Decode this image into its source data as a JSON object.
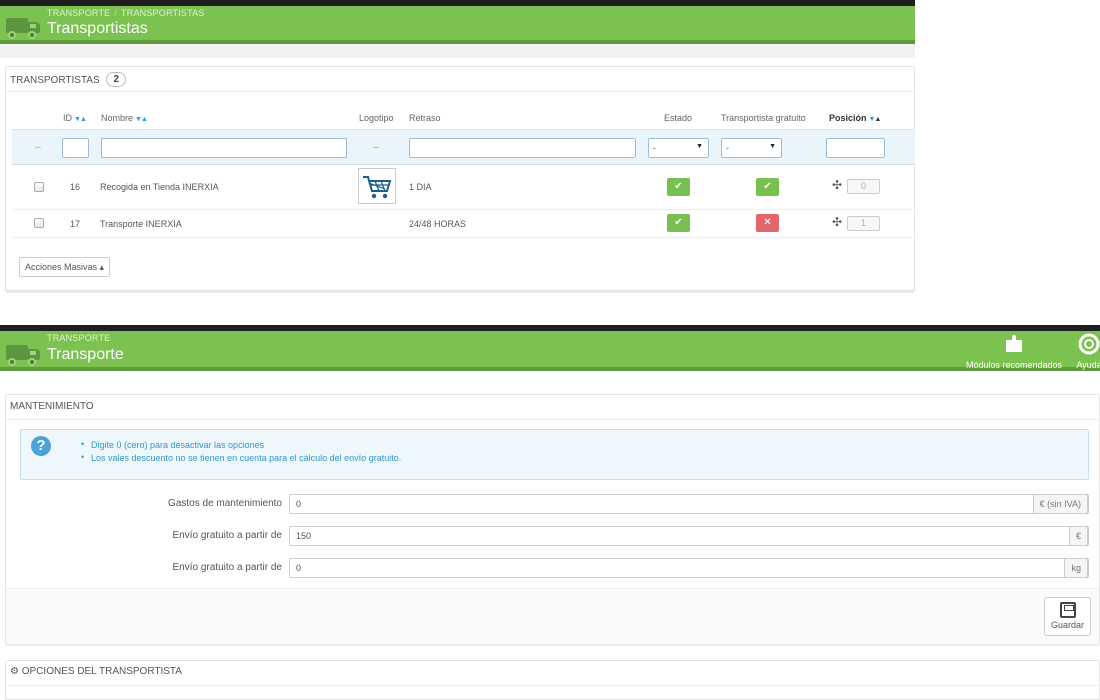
{
  "carriers": {
    "breadcrumb": [
      "TRANSPORTE",
      "TRANSPORTISTAS"
    ],
    "title": "Transportistas",
    "panel_title": "TRANSPORTISTAS",
    "count": "2",
    "columns": {
      "id": "ID",
      "name": "Nombre",
      "logo": "Logotipo",
      "delay": "Retraso",
      "status": "Estado",
      "free": "Transportista gratuito",
      "position": "Posición"
    },
    "filters": {
      "dash1": "--",
      "dash2": "--",
      "status_select": "-",
      "free_select": "-"
    },
    "rows": [
      {
        "id": "16",
        "name": "Recogida en Tienda INERXIA",
        "delay": "1 DIA",
        "status": "enabled",
        "free": "yes",
        "position": "0",
        "has_logo": true
      },
      {
        "id": "17",
        "name": "Transporte INERXIA",
        "delay": "24/48 HORAS",
        "status": "enabled",
        "free": "no",
        "position": "1",
        "has_logo": false
      }
    ],
    "bulk_actions": "Acciones Masivas ▴"
  },
  "transport": {
    "breadcrumb": "TRANSPORTE",
    "title": "Transporte",
    "header_buttons": [
      {
        "label": "Módulos recomendados",
        "icon": "puzzle-icon"
      },
      {
        "label": "Ayuda",
        "icon": "lifebuoy-icon"
      }
    ],
    "panel_title": "MANTENIMIENTO",
    "info": [
      "Digite 0 (cero) para desactivar las opciones",
      "Los vales descuento no se tienen en cuenta para el cálculo del envío gratuito."
    ],
    "fields": [
      {
        "label": "Gastos de mantenimiento",
        "value": "0",
        "suffix": "€ (sin IVA)"
      },
      {
        "label": "Envío gratuito a partir de",
        "value": "150",
        "suffix": "€"
      },
      {
        "label": "Envío gratuito a partir de",
        "value": "0",
        "suffix": "kg"
      }
    ],
    "save_label": "Guardar",
    "options_title": "OPCIONES DEL TRANSPORTISTA"
  },
  "colors": {
    "header_green": "#7cc250",
    "enabled": "#78c150",
    "disabled": "#e3676a",
    "info_blue": "#3598c8"
  }
}
